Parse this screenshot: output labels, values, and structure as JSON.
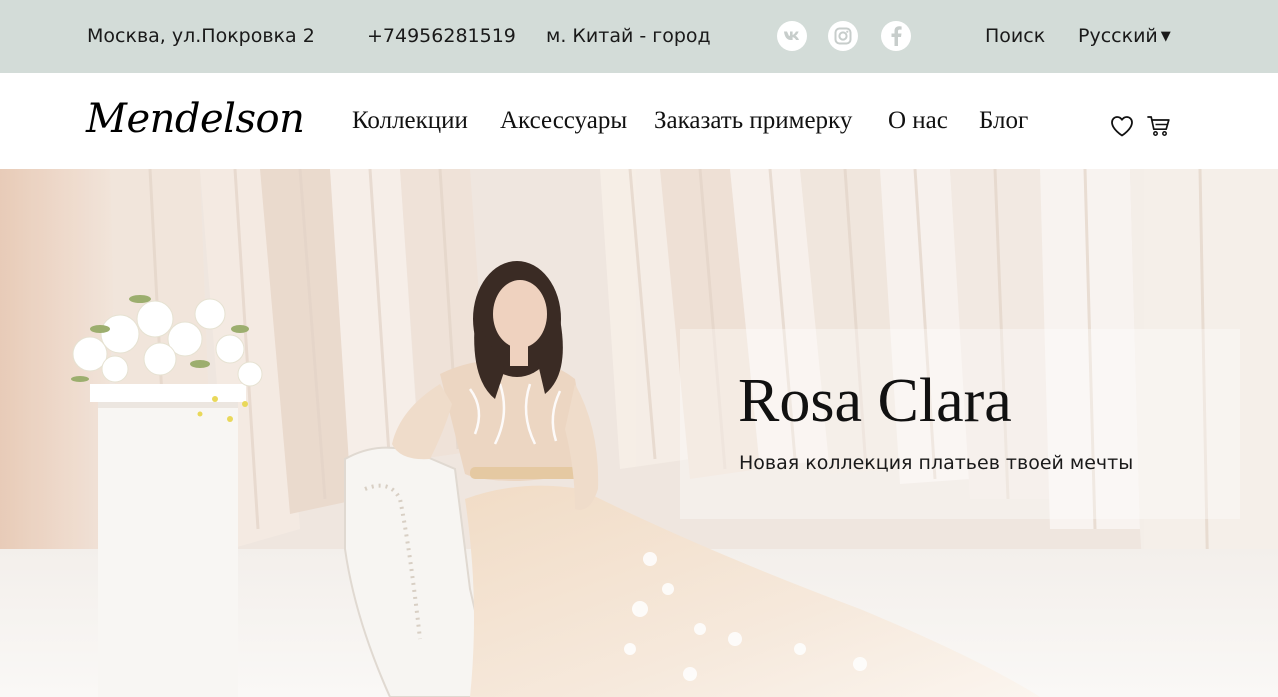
{
  "topbar": {
    "address": "Москва, ул.Покровка 2",
    "phone": "+74956281519",
    "metro": "м. Китай - город",
    "search_label": "Поиск",
    "language": "Русский",
    "social": [
      "vk-icon",
      "instagram-icon",
      "facebook-icon"
    ]
  },
  "header": {
    "logo": "Mendelson",
    "nav": [
      "Коллекции",
      "Аксессуары",
      "Заказать примерку",
      "О нас",
      "Блог"
    ],
    "icons": [
      "heart-icon",
      "cart-icon"
    ]
  },
  "hero": {
    "title": "Rosa Clara",
    "subtitle": "Новая коллекция платьев твоей мечты"
  },
  "colors": {
    "topbar_bg": "#d3dcd8",
    "navbar_bg": "#ffffff",
    "text": "#111111"
  }
}
